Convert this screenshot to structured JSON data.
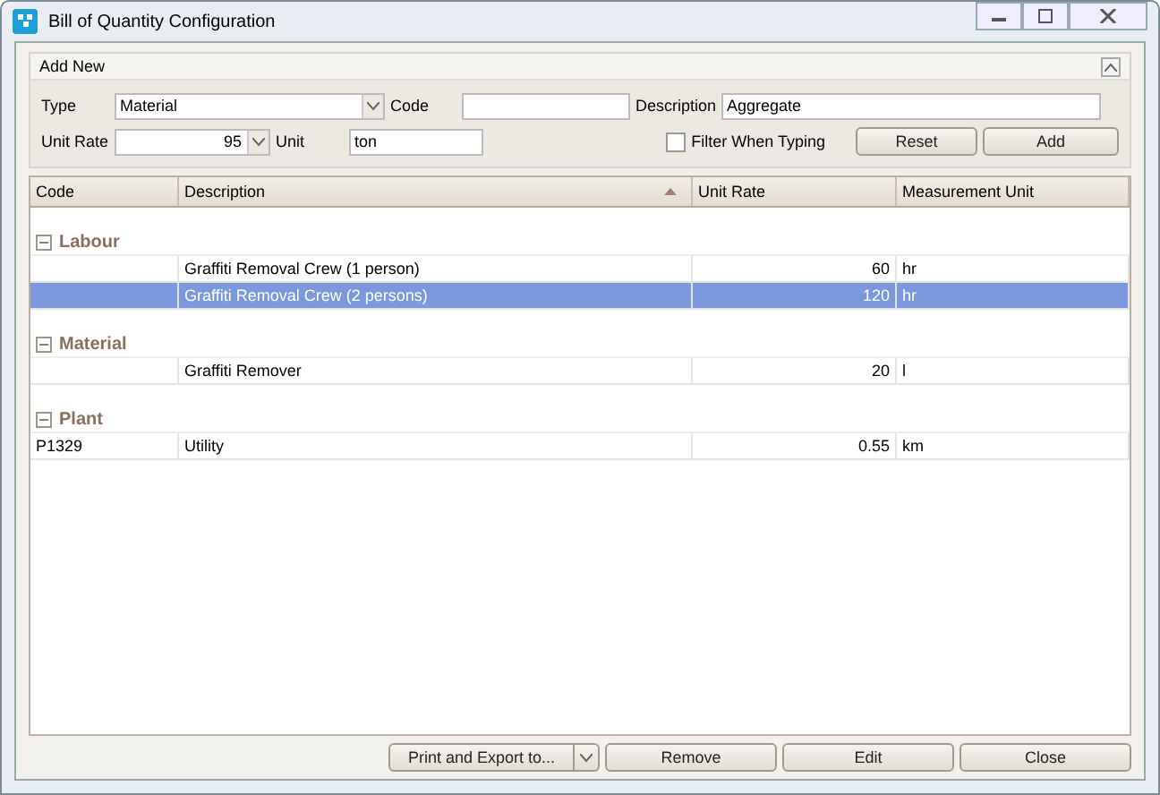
{
  "window": {
    "title": "Bill of Quantity Configuration"
  },
  "add_new": {
    "title": "Add New",
    "expanded": true,
    "type_label": "Type",
    "type_value": "Material",
    "code_label": "Code",
    "description_label": "Description",
    "description_value": "Aggregate",
    "unit_rate_label": "Unit Rate",
    "unit_rate_value": "95",
    "unit_label": "Unit",
    "unit_value": "ton",
    "filter_label": "Filter When Typing",
    "filter_checked": false,
    "buttons": [
      "Reset",
      "Add"
    ]
  },
  "table": {
    "columns": [
      {
        "label": "Code",
        "sorted": false
      },
      {
        "label": "Description",
        "sorted": true
      },
      {
        "label": "Unit Rate",
        "sorted": false
      },
      {
        "label": "Measurement Unit",
        "sorted": false
      }
    ],
    "groups": [
      {
        "name": "Labour",
        "expanded": true,
        "rows": [
          {
            "description": "Graffiti Removal Crew (1 person)",
            "unit_rate": "60",
            "unit": "hr",
            "selected": false
          },
          {
            "description": "Graffiti Removal Crew (2 persons)",
            "unit_rate": "120",
            "unit": "hr",
            "selected": true
          }
        ]
      },
      {
        "name": "Material",
        "expanded": true,
        "rows": [
          {
            "description": "Graffiti Remover",
            "unit_rate": "20",
            "unit": "l",
            "selected": false
          }
        ]
      },
      {
        "name": "Plant",
        "expanded": true,
        "rows": [
          {
            "code": "P1329",
            "description": "Utility",
            "unit_rate": "0.55",
            "unit": "km",
            "selected": false
          }
        ]
      }
    ]
  },
  "footer_buttons": [
    {
      "label": "Print and Export to...",
      "kind": "split"
    },
    {
      "label": "Remove",
      "kind": "plain"
    },
    {
      "label": "Edit",
      "kind": "plain"
    },
    {
      "label": "Close",
      "kind": "plain"
    }
  ]
}
